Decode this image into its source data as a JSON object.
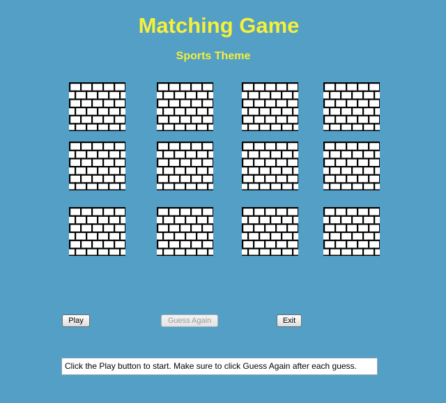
{
  "game": {
    "title": "Matching Game",
    "theme": "Sports Theme"
  },
  "board": {
    "rows": 3,
    "columns": 4,
    "cards": [
      {
        "face": "hidden",
        "back": "brick-wall-icon"
      },
      {
        "face": "hidden",
        "back": "brick-wall-icon"
      },
      {
        "face": "hidden",
        "back": "brick-wall-icon"
      },
      {
        "face": "hidden",
        "back": "brick-wall-icon"
      },
      {
        "face": "hidden",
        "back": "brick-wall-icon"
      },
      {
        "face": "hidden",
        "back": "brick-wall-icon"
      },
      {
        "face": "hidden",
        "back": "brick-wall-icon"
      },
      {
        "face": "hidden",
        "back": "brick-wall-icon"
      },
      {
        "face": "hidden",
        "back": "brick-wall-icon"
      },
      {
        "face": "hidden",
        "back": "brick-wall-icon"
      },
      {
        "face": "hidden",
        "back": "brick-wall-icon"
      },
      {
        "face": "hidden",
        "back": "brick-wall-icon"
      }
    ]
  },
  "controls": {
    "play_label": "Play",
    "guess_again_label": "Guess Again",
    "guess_again_enabled": false,
    "exit_label": "Exit"
  },
  "status": {
    "message": "Click the Play button to start. Make sure to click Guess Again after each guess."
  },
  "colors": {
    "background": "#539fc5",
    "title": "#f5f03a",
    "brick_mortar": "#000000",
    "brick_face": "#ffffff"
  }
}
